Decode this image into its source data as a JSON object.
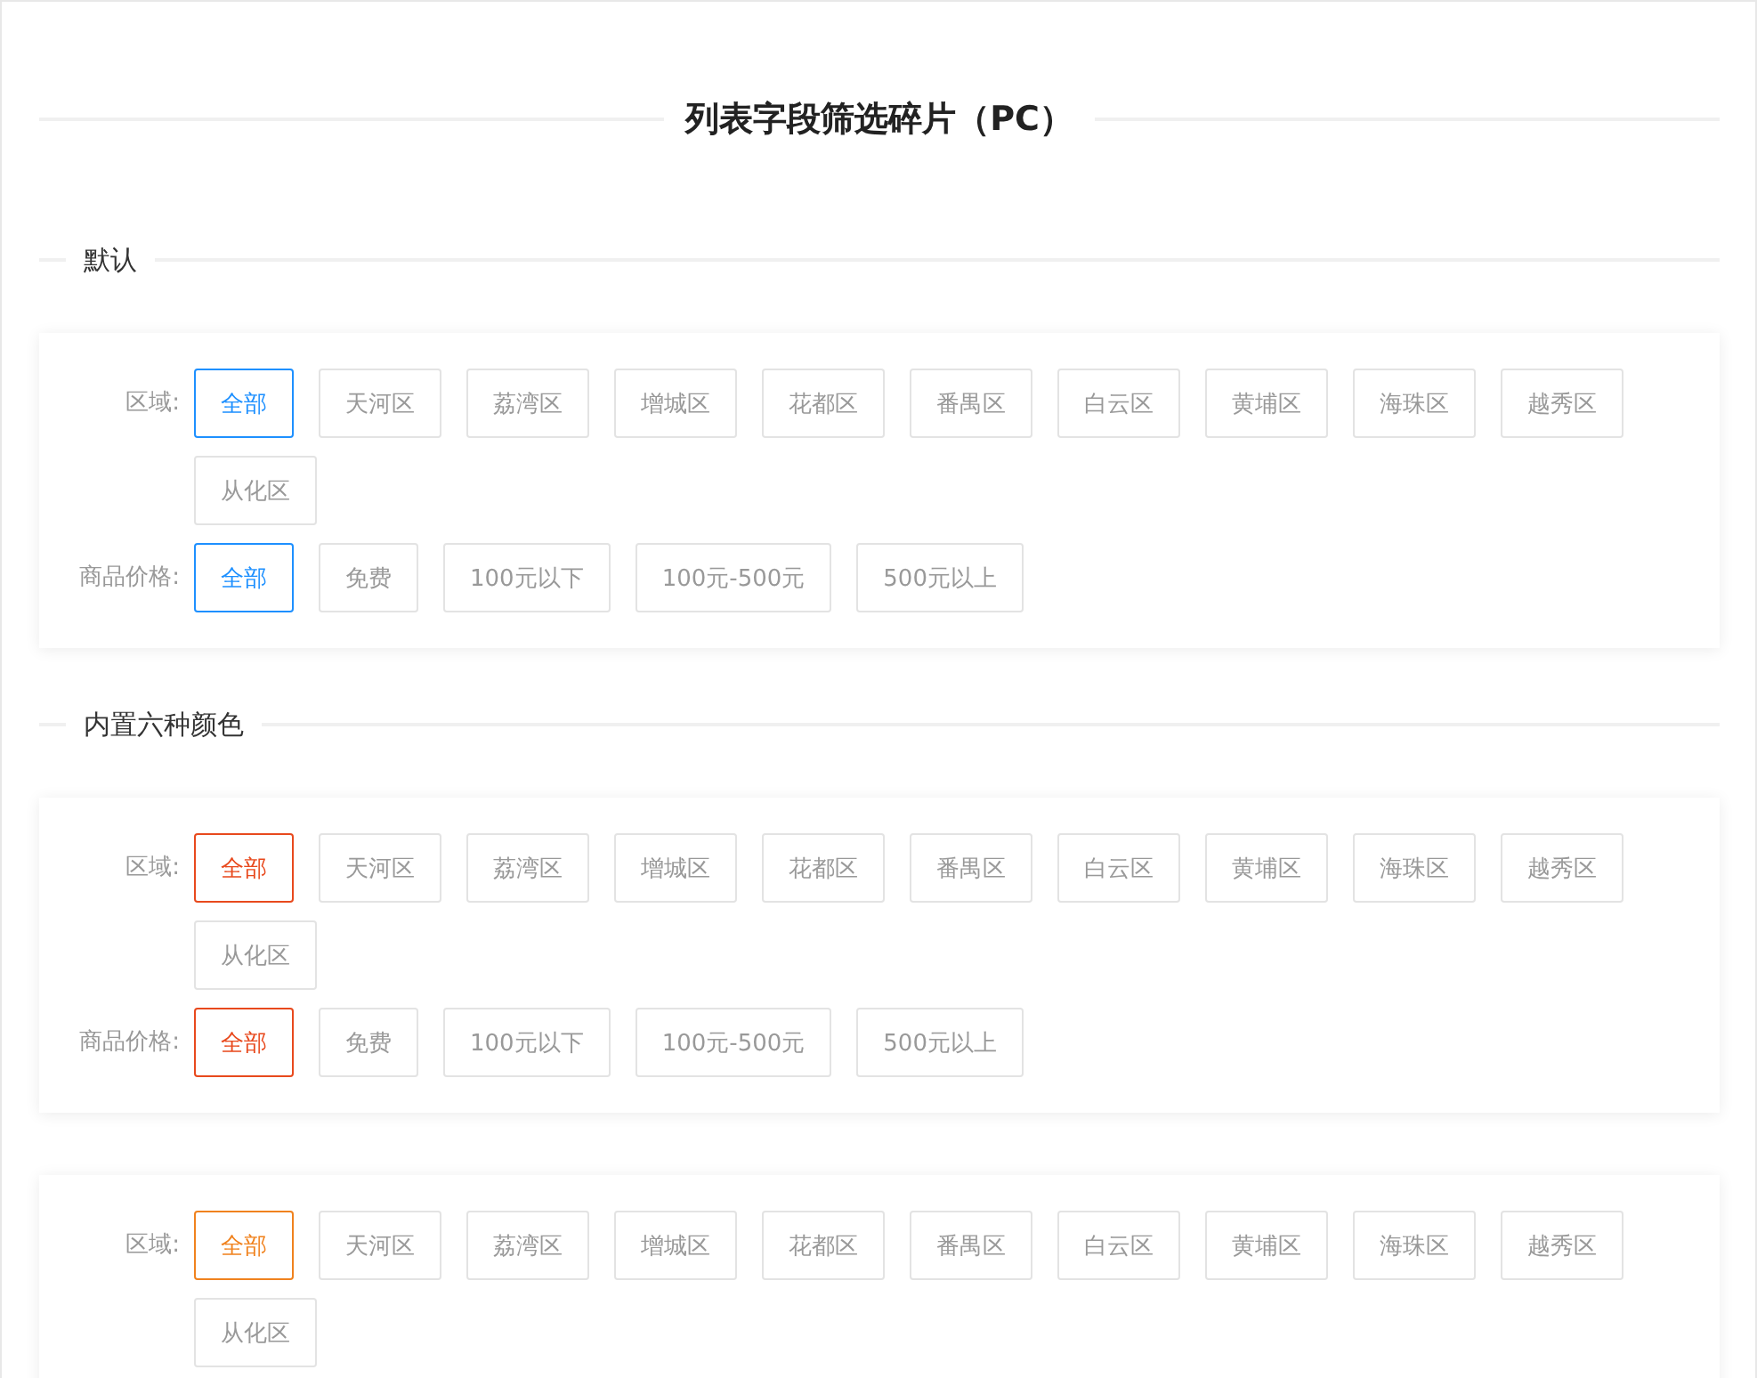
{
  "title": "列表字段筛选碎片（PC）",
  "blocks": [
    {
      "kind": "heading",
      "text": "默认"
    },
    {
      "kind": "card",
      "color": "#1e90ff",
      "filters": [
        {
          "label": "区域:",
          "options": [
            {
              "text": "全部",
              "selected": true
            },
            {
              "text": "天河区",
              "selected": false
            },
            {
              "text": "荔湾区",
              "selected": false
            },
            {
              "text": "增城区",
              "selected": false
            },
            {
              "text": "花都区",
              "selected": false
            },
            {
              "text": "番禺区",
              "selected": false
            },
            {
              "text": "白云区",
              "selected": false
            },
            {
              "text": "黄埔区",
              "selected": false
            },
            {
              "text": "海珠区",
              "selected": false
            },
            {
              "text": "越秀区",
              "selected": false
            },
            {
              "text": "从化区",
              "selected": false
            }
          ]
        },
        {
          "label": "商品价格:",
          "options": [
            {
              "text": "全部",
              "selected": true
            },
            {
              "text": "免费",
              "selected": false
            },
            {
              "text": "100元以下",
              "selected": false
            },
            {
              "text": "100元-500元",
              "selected": false
            },
            {
              "text": "500元以上",
              "selected": false
            }
          ]
        }
      ]
    },
    {
      "kind": "heading",
      "text": "内置六种颜色"
    },
    {
      "kind": "card",
      "color": "#e8491d",
      "filters": [
        {
          "label": "区域:",
          "options": [
            {
              "text": "全部",
              "selected": true
            },
            {
              "text": "天河区",
              "selected": false
            },
            {
              "text": "荔湾区",
              "selected": false
            },
            {
              "text": "增城区",
              "selected": false
            },
            {
              "text": "花都区",
              "selected": false
            },
            {
              "text": "番禺区",
              "selected": false
            },
            {
              "text": "白云区",
              "selected": false
            },
            {
              "text": "黄埔区",
              "selected": false
            },
            {
              "text": "海珠区",
              "selected": false
            },
            {
              "text": "越秀区",
              "selected": false
            },
            {
              "text": "从化区",
              "selected": false
            }
          ]
        },
        {
          "label": "商品价格:",
          "options": [
            {
              "text": "全部",
              "selected": true
            },
            {
              "text": "免费",
              "selected": false
            },
            {
              "text": "100元以下",
              "selected": false
            },
            {
              "text": "100元-500元",
              "selected": false
            },
            {
              "text": "500元以上",
              "selected": false
            }
          ]
        }
      ]
    },
    {
      "kind": "card",
      "color": "#f0821e",
      "filters": [
        {
          "label": "区域:",
          "options": [
            {
              "text": "全部",
              "selected": true
            },
            {
              "text": "天河区",
              "selected": false
            },
            {
              "text": "荔湾区",
              "selected": false
            },
            {
              "text": "增城区",
              "selected": false
            },
            {
              "text": "花都区",
              "selected": false
            },
            {
              "text": "番禺区",
              "selected": false
            },
            {
              "text": "白云区",
              "selected": false
            },
            {
              "text": "黄埔区",
              "selected": false
            },
            {
              "text": "海珠区",
              "selected": false
            },
            {
              "text": "越秀区",
              "selected": false
            },
            {
              "text": "从化区",
              "selected": false
            }
          ]
        }
      ]
    }
  ]
}
